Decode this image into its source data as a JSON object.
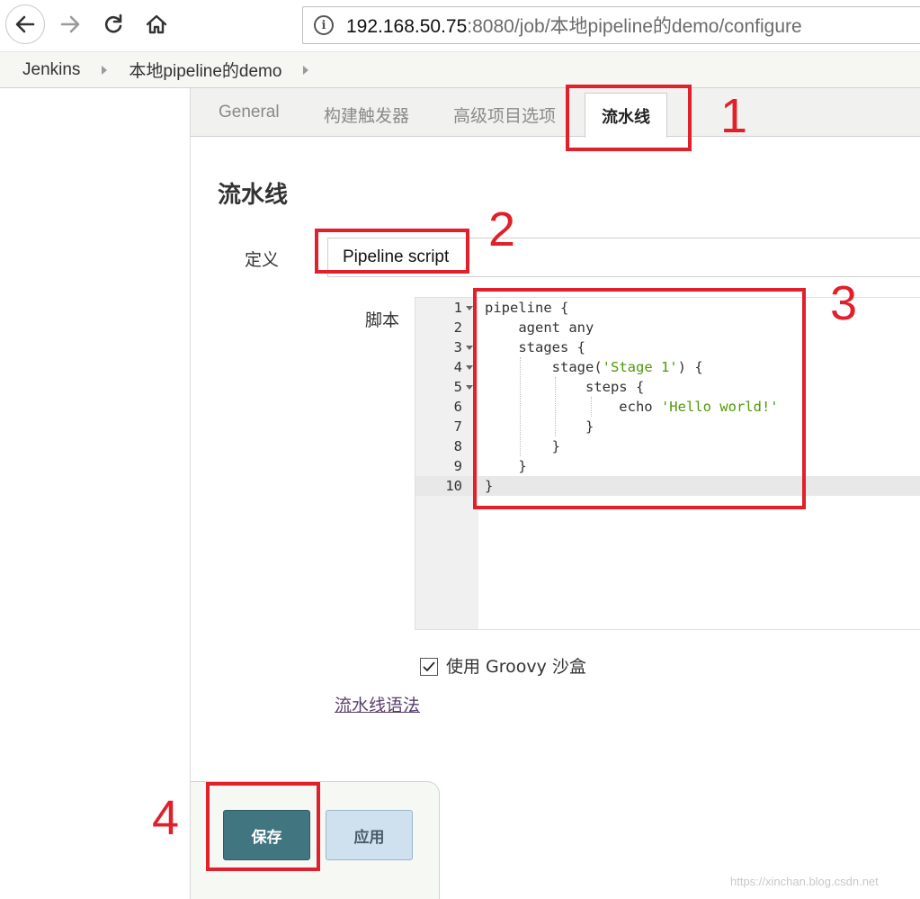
{
  "browser": {
    "url_host": "192.168.50.75",
    "url_rest": ":8080/job/本地pipeline的demo/configure"
  },
  "breadcrumb": {
    "items": [
      "Jenkins",
      "本地pipeline的demo"
    ]
  },
  "tabs": [
    {
      "label": "General"
    },
    {
      "label": "构建触发器"
    },
    {
      "label": "高级项目选项"
    },
    {
      "label": "流水线",
      "active": true
    }
  ],
  "section": {
    "title": "流水线"
  },
  "definition": {
    "label": "定义",
    "value": "Pipeline script"
  },
  "script": {
    "label": "脚本",
    "line_numbers": [
      "1",
      "2",
      "3",
      "4",
      "5",
      "6",
      "7",
      "8",
      "9",
      "10"
    ],
    "lines": [
      {
        "pre": "pipeline {",
        "str": "",
        "post": ""
      },
      {
        "pre": "    agent any",
        "str": "",
        "post": ""
      },
      {
        "pre": "    stages {",
        "str": "",
        "post": ""
      },
      {
        "pre": "        stage(",
        "str": "'Stage 1'",
        "post": ") {"
      },
      {
        "pre": "            steps {",
        "str": "",
        "post": ""
      },
      {
        "pre": "                echo ",
        "str": "'Hello world!'",
        "post": ""
      },
      {
        "pre": "            }",
        "str": "",
        "post": ""
      },
      {
        "pre": "        }",
        "str": "",
        "post": ""
      },
      {
        "pre": "    }",
        "str": "",
        "post": ""
      },
      {
        "pre": "}",
        "str": "",
        "post": ""
      }
    ],
    "active_line": "10"
  },
  "sandbox": {
    "checked": true,
    "label": "使用 Groovy 沙盒"
  },
  "syntax_link": "流水线语法",
  "buttons": {
    "save": "保存",
    "apply": "应用"
  },
  "annotations": [
    "1",
    "2",
    "3",
    "4"
  ],
  "watermark": "https://xinchan.blog.csdn.net",
  "colors": {
    "annotation_red": "#e0202a",
    "save_button": "#417681",
    "apply_button": "#cfe0ee",
    "string_green": "#4e9a06"
  }
}
